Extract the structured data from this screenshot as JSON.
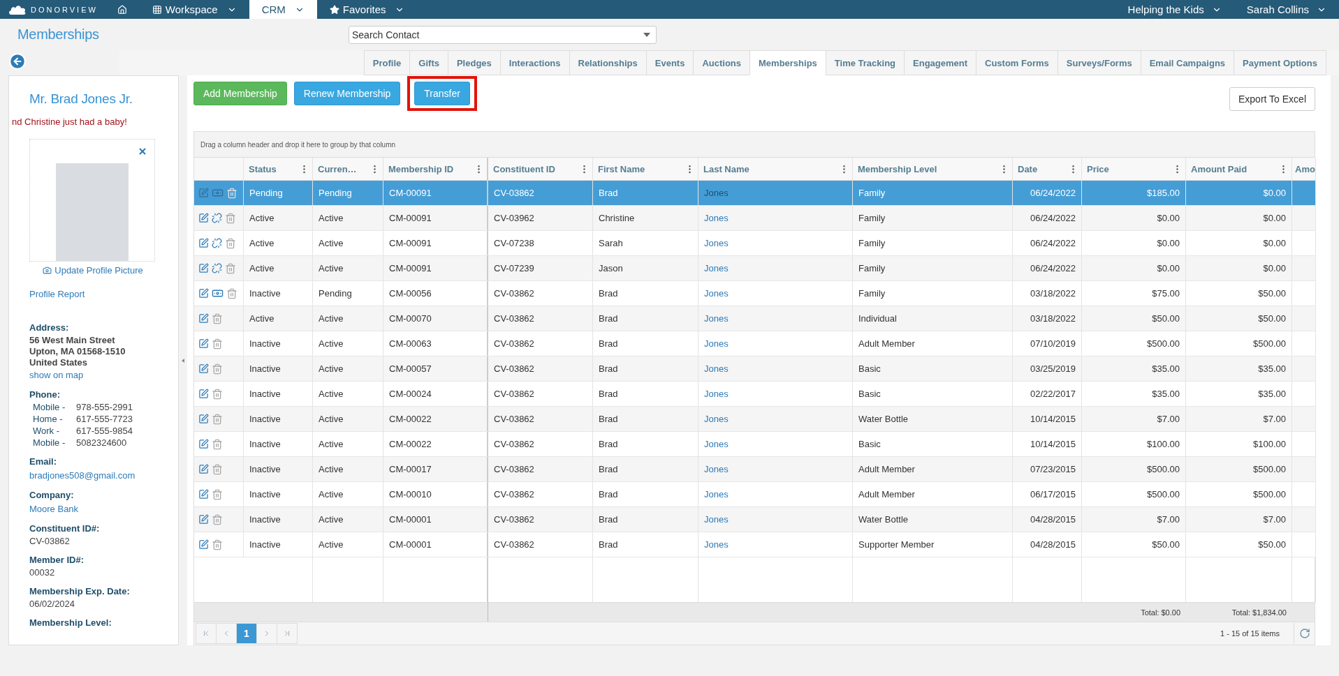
{
  "nav": {
    "logo": "DONORVIEW",
    "items": [
      {
        "label": "Workspace",
        "selected": false
      },
      {
        "label": "CRM",
        "selected": true
      },
      {
        "label": "Favorites",
        "selected": false
      }
    ],
    "right": [
      "Helping the Kids",
      "Sarah Collins"
    ]
  },
  "page_title": "Memberships",
  "search": {
    "placeholder": "Search Contact"
  },
  "tabs": [
    {
      "label": "Profile",
      "selected": false
    },
    {
      "label": "Gifts",
      "selected": false
    },
    {
      "label": "Pledges",
      "selected": false
    },
    {
      "label": "Interactions",
      "selected": false
    },
    {
      "label": "Relationships",
      "selected": false
    },
    {
      "label": "Events",
      "selected": false
    },
    {
      "label": "Auctions",
      "selected": false
    },
    {
      "label": "Memberships",
      "selected": true
    },
    {
      "label": "Time Tracking",
      "selected": false
    },
    {
      "label": "Engagement",
      "selected": false
    },
    {
      "label": "Custom Forms",
      "selected": false
    },
    {
      "label": "Surveys/Forms",
      "selected": false
    },
    {
      "label": "Email Campaigns",
      "selected": false
    },
    {
      "label": "Payment Options",
      "selected": false
    }
  ],
  "profile": {
    "name": "Mr. Brad Jones Jr.",
    "note": "nd Christine just had a baby!",
    "update_picture": "Update Profile Picture",
    "report_link": "Profile Report",
    "address": {
      "label": "Address:",
      "lines": [
        "56 West Main Street",
        "Upton, MA 01568-1510",
        "United States"
      ],
      "map_link": "show on map"
    },
    "phone": {
      "label": "Phone:",
      "numbers": [
        {
          "type": "Mobile -",
          "number": "978-555-2991"
        },
        {
          "type": "Home -",
          "number": "617-555-7723"
        },
        {
          "type": "Work -",
          "number": "617-555-9854"
        },
        {
          "type": "Mobile -",
          "number": "5082324600"
        }
      ]
    },
    "fields": [
      {
        "label": "Email:",
        "value": "bradjones508@gmail.com",
        "kind": "link"
      },
      {
        "label": "Company:",
        "value": "Moore Bank",
        "kind": "link"
      },
      {
        "label": "Constituent ID#:",
        "value": "CV-03862",
        "kind": "text"
      },
      {
        "label": "Member ID#:",
        "value": "00032",
        "kind": "text"
      },
      {
        "label": "Membership Exp. Date:",
        "value": "06/02/2024",
        "kind": "text"
      },
      {
        "label": "Membership Level:"
      }
    ]
  },
  "toolbar": {
    "buttons": [
      {
        "label": "Add Membership",
        "kind": "success",
        "highlighted": false
      },
      {
        "label": "Renew Membership",
        "kind": "primary",
        "highlighted": false
      },
      {
        "label": "Transfer",
        "kind": "primary",
        "highlighted": true
      }
    ],
    "export": "Export To Excel"
  },
  "grid": {
    "group_hint": "Drag a column header and drop it here to group by that column",
    "columns": [
      {
        "label": "Status",
        "kind": "text"
      },
      {
        "label": "Curren…",
        "kind": "text"
      },
      {
        "label": "Membership ID",
        "kind": "text"
      },
      {
        "label": "Constituent ID",
        "kind": "text"
      },
      {
        "label": "First Name",
        "kind": "text"
      },
      {
        "label": "Last Name",
        "kind": "link"
      },
      {
        "label": "Membership Level",
        "kind": "text"
      },
      {
        "label": "Date",
        "kind": "number"
      },
      {
        "label": "Price",
        "kind": "number",
        "total": "Total: $0.00"
      },
      {
        "label": "Amount Paid",
        "kind": "number",
        "total": "Total: $1,834.00"
      },
      {
        "label": "Amo",
        "kind": "text"
      }
    ],
    "rows": [
      {
        "selected": true,
        "actions": [
          {
            "kind": "edit"
          },
          {
            "kind": "money"
          },
          {
            "kind": "trash"
          }
        ],
        "cells": [
          "Pending",
          "Pending",
          "CM-00091",
          "CV-03862",
          "Brad",
          "Jones",
          "Family",
          "06/24/2022",
          "$185.00",
          "$0.00"
        ]
      },
      {
        "selected": false,
        "actions": [
          {
            "kind": "edit"
          },
          {
            "kind": "unlink"
          },
          {
            "kind": "trash"
          }
        ],
        "cells": [
          "Active",
          "Active",
          "CM-00091",
          "CV-03962",
          "Christine",
          "Jones",
          "Family",
          "06/24/2022",
          "$0.00",
          "$0.00"
        ]
      },
      {
        "selected": false,
        "actions": [
          {
            "kind": "edit"
          },
          {
            "kind": "unlink"
          },
          {
            "kind": "trash"
          }
        ],
        "cells": [
          "Active",
          "Active",
          "CM-00091",
          "CV-07238",
          "Sarah",
          "Jones",
          "Family",
          "06/24/2022",
          "$0.00",
          "$0.00"
        ]
      },
      {
        "selected": false,
        "actions": [
          {
            "kind": "edit"
          },
          {
            "kind": "unlink"
          },
          {
            "kind": "trash"
          }
        ],
        "cells": [
          "Active",
          "Active",
          "CM-00091",
          "CV-07239",
          "Jason",
          "Jones",
          "Family",
          "06/24/2022",
          "$0.00",
          "$0.00"
        ]
      },
      {
        "selected": false,
        "actions": [
          {
            "kind": "edit"
          },
          {
            "kind": "money"
          },
          {
            "kind": "trash"
          }
        ],
        "cells": [
          "Inactive",
          "Pending",
          "CM-00056",
          "CV-03862",
          "Brad",
          "Jones",
          "Family",
          "03/18/2022",
          "$75.00",
          "$50.00"
        ]
      },
      {
        "selected": false,
        "actions": [
          {
            "kind": "edit"
          },
          {
            "kind": "trash"
          }
        ],
        "cells": [
          "Active",
          "Active",
          "CM-00070",
          "CV-03862",
          "Brad",
          "Jones",
          "Individual",
          "03/18/2022",
          "$50.00",
          "$50.00"
        ]
      },
      {
        "selected": false,
        "actions": [
          {
            "kind": "edit"
          },
          {
            "kind": "trash"
          }
        ],
        "cells": [
          "Inactive",
          "Active",
          "CM-00063",
          "CV-03862",
          "Brad",
          "Jones",
          "Adult Member",
          "07/10/2019",
          "$500.00",
          "$500.00"
        ]
      },
      {
        "selected": false,
        "actions": [
          {
            "kind": "edit"
          },
          {
            "kind": "trash"
          }
        ],
        "cells": [
          "Inactive",
          "Active",
          "CM-00057",
          "CV-03862",
          "Brad",
          "Jones",
          "Basic",
          "03/25/2019",
          "$35.00",
          "$35.00"
        ]
      },
      {
        "selected": false,
        "actions": [
          {
            "kind": "edit"
          },
          {
            "kind": "trash"
          }
        ],
        "cells": [
          "Inactive",
          "Active",
          "CM-00024",
          "CV-03862",
          "Brad",
          "Jones",
          "Basic",
          "02/22/2017",
          "$35.00",
          "$35.00"
        ]
      },
      {
        "selected": false,
        "actions": [
          {
            "kind": "edit"
          },
          {
            "kind": "trash"
          }
        ],
        "cells": [
          "Inactive",
          "Active",
          "CM-00022",
          "CV-03862",
          "Brad",
          "Jones",
          "Water Bottle",
          "10/14/2015",
          "$7.00",
          "$7.00"
        ]
      },
      {
        "selected": false,
        "actions": [
          {
            "kind": "edit"
          },
          {
            "kind": "trash"
          }
        ],
        "cells": [
          "Inactive",
          "Active",
          "CM-00022",
          "CV-03862",
          "Brad",
          "Jones",
          "Basic",
          "10/14/2015",
          "$100.00",
          "$100.00"
        ]
      },
      {
        "selected": false,
        "actions": [
          {
            "kind": "edit"
          },
          {
            "kind": "trash"
          }
        ],
        "cells": [
          "Inactive",
          "Active",
          "CM-00017",
          "CV-03862",
          "Brad",
          "Jones",
          "Adult Member",
          "07/23/2015",
          "$500.00",
          "$500.00"
        ]
      },
      {
        "selected": false,
        "actions": [
          {
            "kind": "edit"
          },
          {
            "kind": "trash"
          }
        ],
        "cells": [
          "Inactive",
          "Active",
          "CM-00010",
          "CV-03862",
          "Brad",
          "Jones",
          "Adult Member",
          "06/17/2015",
          "$500.00",
          "$500.00"
        ]
      },
      {
        "selected": false,
        "actions": [
          {
            "kind": "edit"
          },
          {
            "kind": "trash"
          }
        ],
        "cells": [
          "Inactive",
          "Active",
          "CM-00001",
          "CV-03862",
          "Brad",
          "Jones",
          "Water Bottle",
          "04/28/2015",
          "$7.00",
          "$7.00"
        ]
      },
      {
        "selected": false,
        "actions": [
          {
            "kind": "edit"
          },
          {
            "kind": "trash"
          }
        ],
        "cells": [
          "Inactive",
          "Active",
          "CM-00001",
          "CV-03862",
          "Brad",
          "Jones",
          "Supporter Member",
          "04/28/2015",
          "$50.00",
          "$50.00"
        ]
      }
    ],
    "pager": {
      "pages": [
        {
          "label": "1",
          "selected": true
        }
      ],
      "summary": "1 - 15 of 15 items"
    }
  }
}
